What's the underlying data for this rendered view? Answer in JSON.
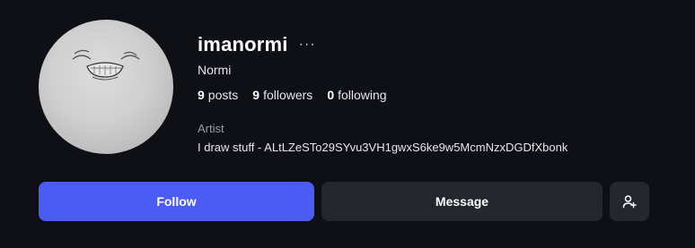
{
  "profile": {
    "username": "imanormi",
    "display_name": "Normi",
    "category": "Artist",
    "bio": "I draw stuff - ALtLZeSTo29SYvu3VH1gwxS6ke9w5McmNzxDGDfXbonk"
  },
  "stats": {
    "posts_count": "9",
    "posts_label": "posts",
    "followers_count": "9",
    "followers_label": "followers",
    "following_count": "0",
    "following_label": "following"
  },
  "actions": {
    "more_label": "···",
    "follow_label": "Follow",
    "message_label": "Message",
    "add_user_icon": "person-add-icon"
  },
  "colors": {
    "background": "#0e1016",
    "accent": "#4b5cf5",
    "secondary_button": "#25272e"
  }
}
